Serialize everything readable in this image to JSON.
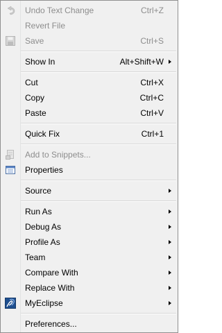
{
  "menu": {
    "undo": {
      "label": "Undo Text Change",
      "accel": "Ctrl+Z",
      "icon": "undo-icon",
      "enabled": false
    },
    "revert": {
      "label": "Revert File",
      "enabled": false
    },
    "save": {
      "label": "Save",
      "accel": "Ctrl+S",
      "icon": "save-icon",
      "enabled": false
    },
    "show_in": {
      "label": "Show In",
      "accel": "Alt+Shift+W"
    },
    "cut": {
      "label": "Cut",
      "accel": "Ctrl+X"
    },
    "copy": {
      "label": "Copy",
      "accel": "Ctrl+C"
    },
    "paste": {
      "label": "Paste",
      "accel": "Ctrl+V"
    },
    "quick_fix": {
      "label": "Quick Fix",
      "accel": "Ctrl+1"
    },
    "add_snippets": {
      "label": "Add to Snippets...",
      "icon": "snippet-icon",
      "enabled": false
    },
    "properties": {
      "label": "Properties",
      "icon": "properties-icon"
    },
    "source": {
      "label": "Source"
    },
    "run_as": {
      "label": "Run As"
    },
    "debug_as": {
      "label": "Debug As"
    },
    "profile_as": {
      "label": "Profile As"
    },
    "team": {
      "label": "Team"
    },
    "compare_with": {
      "label": "Compare With"
    },
    "replace_with": {
      "label": "Replace With"
    },
    "myeclipse": {
      "label": "MyEclipse",
      "icon": "myeclipse-icon"
    },
    "preferences": {
      "label": "Preferences..."
    }
  },
  "colors": {
    "disabled_text": "#8d8d8d",
    "menu_background": "#f0f0f0",
    "separator": "#d7d7d7",
    "myeclipse_icon_bg": "#1f4f8f"
  }
}
